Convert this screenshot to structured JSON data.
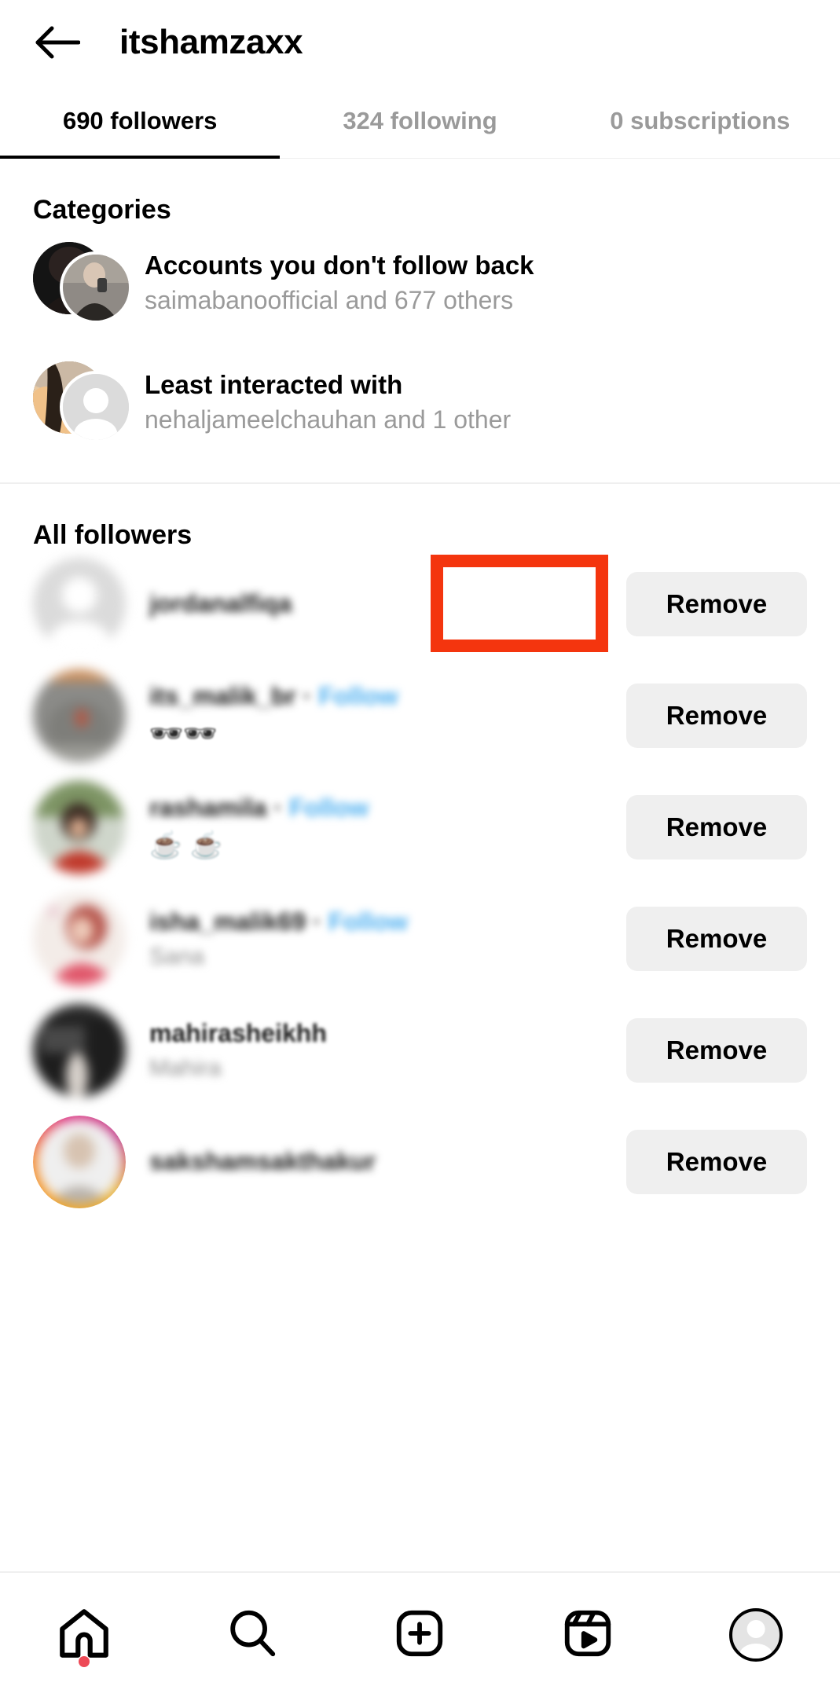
{
  "header": {
    "back_icon": "back-arrow-icon",
    "title": "itshamzaxx"
  },
  "tabs": [
    {
      "label": "690 followers",
      "active": true
    },
    {
      "label": "324 following",
      "active": false
    },
    {
      "label": "0 subscriptions",
      "active": false
    }
  ],
  "categories_section": {
    "heading": "Categories",
    "items": [
      {
        "title": "Accounts you don't follow back",
        "subtitle": "saimabanoofficial and 677 others"
      },
      {
        "title": "Least interacted with",
        "subtitle": "nehaljameelchauhan and 1 other"
      }
    ]
  },
  "all_followers_section": {
    "heading": "All followers",
    "rows": [
      {
        "username": "jordanalfiqa",
        "follow_label": "",
        "subtitle": "",
        "action_label": "Remove"
      },
      {
        "username": "its_malik_br",
        "follow_label": "Follow",
        "subtitle": "🕶🕶",
        "action_label": "Remove"
      },
      {
        "username": "rashamila",
        "follow_label": "Follow",
        "subtitle": "☕ ☕",
        "action_label": "Remove"
      },
      {
        "username": "isha_malik69",
        "follow_label": "Follow",
        "subtitle": "Sana",
        "action_label": "Remove"
      },
      {
        "username": "mahirasheikhh",
        "follow_label": "",
        "subtitle": "Mahira",
        "action_label": "Remove"
      },
      {
        "username": "sakshamsakthakur",
        "follow_label": "",
        "subtitle": "",
        "action_label": "Remove"
      }
    ]
  },
  "annotation": {
    "target": "Remove",
    "color": "#F4350E"
  },
  "bottom_nav": [
    {
      "icon": "home-icon",
      "badge": true
    },
    {
      "icon": "search-icon",
      "badge": false
    },
    {
      "icon": "create-post-icon",
      "badge": false
    },
    {
      "icon": "reels-icon",
      "badge": false
    },
    {
      "icon": "profile-avatar-icon",
      "badge": false
    }
  ]
}
